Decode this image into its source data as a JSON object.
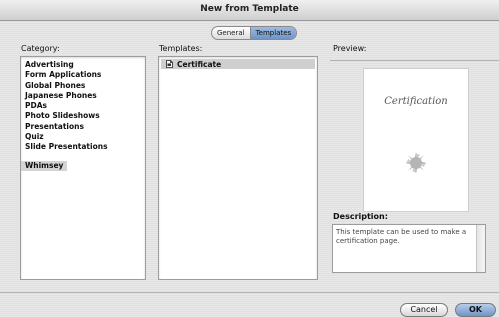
{
  "window": {
    "title": "New from Template"
  },
  "tabs": [
    {
      "label": "General"
    },
    {
      "label": "Templates"
    }
  ],
  "category": {
    "label": "Category:",
    "items": [
      "Advertising",
      "Form Applications",
      "Global Phones",
      "Japanese Phones",
      "PDAs",
      "Photo Slideshows",
      "Presentations",
      "Quiz",
      "Slide Presentations",
      "Whimsey"
    ],
    "selected": "Whimsey"
  },
  "templates": {
    "label": "Templates:",
    "items": [
      {
        "label": "Certificate",
        "icon": "document-icon"
      }
    ]
  },
  "preview": {
    "label": "Preview:",
    "card_text": "Certification"
  },
  "description": {
    "label": "Description:",
    "text": "This template can be used to make a certification page."
  },
  "buttons": {
    "cancel": "Cancel",
    "ok": "OK"
  },
  "colors": {
    "selection": "#d4d4d4",
    "default_button": "#6f95c8"
  }
}
